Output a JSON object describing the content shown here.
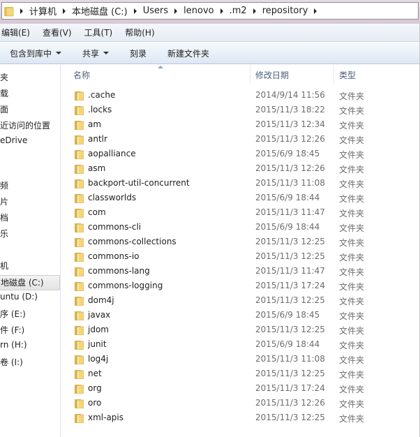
{
  "address": {
    "crumbs": [
      "计算机",
      "本地磁盘 (C:)",
      "Users",
      "lenovo",
      ".m2",
      "repository"
    ]
  },
  "menu": [
    "编辑(E)",
    "查看(V)",
    "工具(T)",
    "帮助(H)"
  ],
  "toolbar": {
    "include_library": "包含到库中",
    "share": "共享",
    "burn": "刻录",
    "new_folder": "新建文件夹"
  },
  "sidebar": [
    "夹",
    "载",
    "面",
    "近访问的位置",
    "eDrive",
    "频",
    "片",
    "档",
    "乐",
    "机",
    "地磁盘 (C:)",
    "untu (D:)",
    "序 (E:)",
    "件 (F:)",
    "rn (H:)",
    "卷 (I:)"
  ],
  "sidebar_selected": 10,
  "columns": {
    "name": "名称",
    "date": "修改日期",
    "type": "类型"
  },
  "files": [
    {
      "name": ".cache",
      "date": "2014/9/14 11:56",
      "type": "文件夹"
    },
    {
      "name": ".locks",
      "date": "2015/11/3 18:22",
      "type": "文件夹"
    },
    {
      "name": "am",
      "date": "2015/11/3 12:34",
      "type": "文件夹"
    },
    {
      "name": "antlr",
      "date": "2015/11/3 12:26",
      "type": "文件夹"
    },
    {
      "name": "aopalliance",
      "date": "2015/6/9 18:45",
      "type": "文件夹"
    },
    {
      "name": "asm",
      "date": "2015/11/3 12:26",
      "type": "文件夹"
    },
    {
      "name": "backport-util-concurrent",
      "date": "2015/11/3 11:08",
      "type": "文件夹"
    },
    {
      "name": "classworlds",
      "date": "2015/6/9 18:44",
      "type": "文件夹"
    },
    {
      "name": "com",
      "date": "2015/11/3 11:47",
      "type": "文件夹"
    },
    {
      "name": "commons-cli",
      "date": "2015/6/9 18:44",
      "type": "文件夹"
    },
    {
      "name": "commons-collections",
      "date": "2015/11/3 12:25",
      "type": "文件夹"
    },
    {
      "name": "commons-io",
      "date": "2015/11/3 12:25",
      "type": "文件夹"
    },
    {
      "name": "commons-lang",
      "date": "2015/11/3 11:47",
      "type": "文件夹"
    },
    {
      "name": "commons-logging",
      "date": "2015/11/3 17:24",
      "type": "文件夹"
    },
    {
      "name": "dom4j",
      "date": "2015/11/3 12:25",
      "type": "文件夹"
    },
    {
      "name": "javax",
      "date": "2015/6/9 18:45",
      "type": "文件夹"
    },
    {
      "name": "jdom",
      "date": "2015/11/3 12:25",
      "type": "文件夹"
    },
    {
      "name": "junit",
      "date": "2015/6/9 18:44",
      "type": "文件夹"
    },
    {
      "name": "log4j",
      "date": "2015/11/3 11:08",
      "type": "文件夹"
    },
    {
      "name": "net",
      "date": "2015/11/3 12:25",
      "type": "文件夹"
    },
    {
      "name": "org",
      "date": "2015/11/3 17:24",
      "type": "文件夹"
    },
    {
      "name": "oro",
      "date": "2015/11/3 12:26",
      "type": "文件夹"
    },
    {
      "name": "xml-apis",
      "date": "2015/11/3 12:25",
      "type": "文件夹"
    }
  ]
}
